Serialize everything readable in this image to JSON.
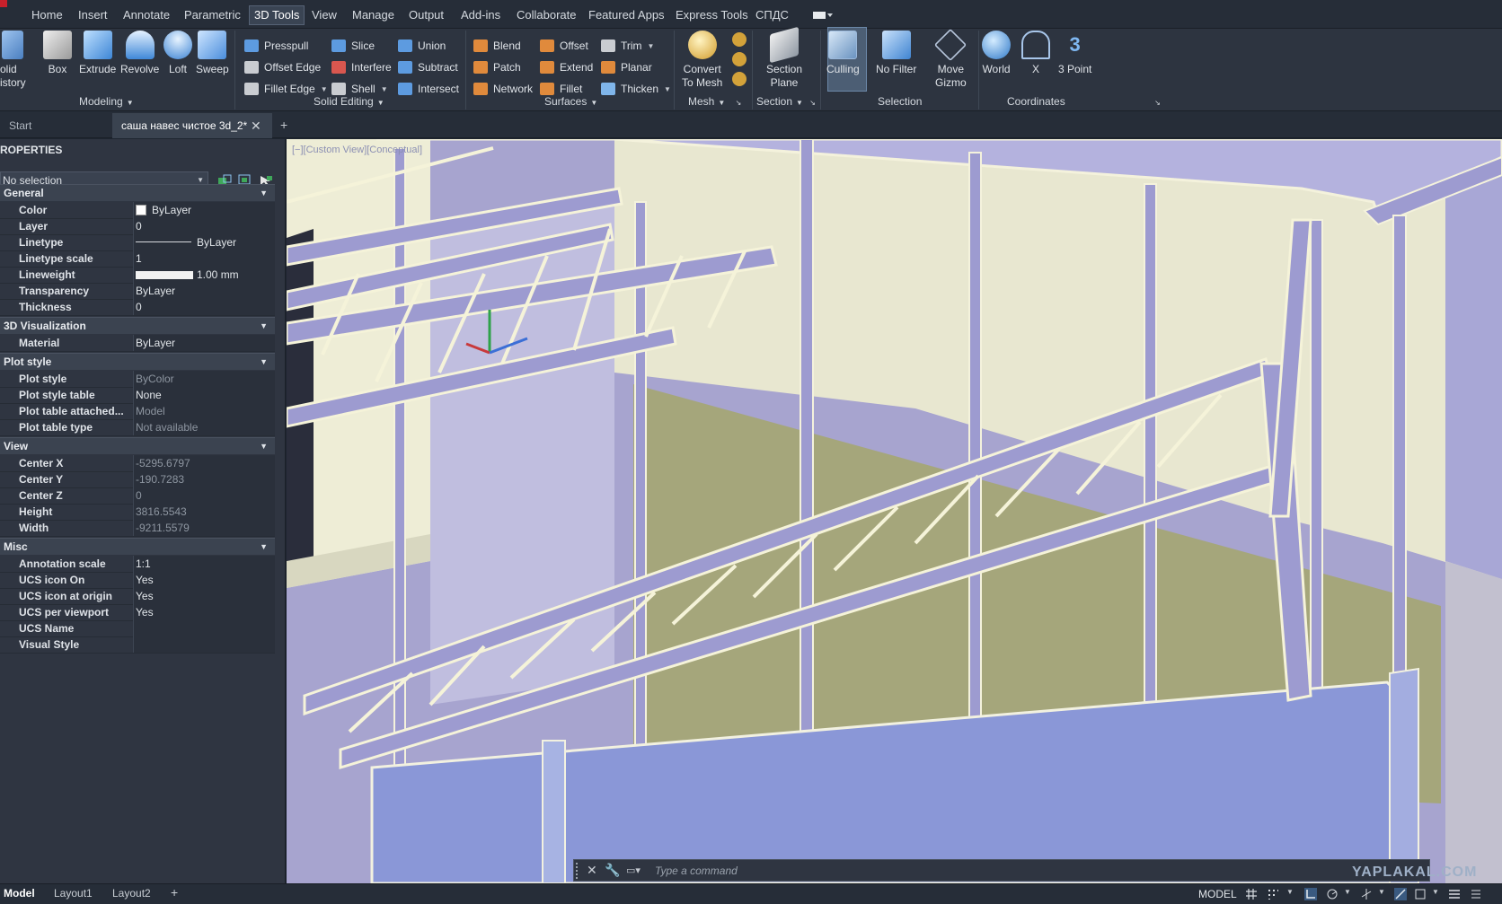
{
  "menubar": {
    "tabs": [
      "Home",
      "Insert",
      "Annotate",
      "Parametric",
      "3D Tools",
      "View",
      "Manage",
      "Output",
      "Add-ins",
      "Collaborate",
      "Featured Apps",
      "Express Tools",
      "СПДС"
    ],
    "active_tab": "3D Tools"
  },
  "ribbon": {
    "modeling": {
      "title": "Modeling",
      "solid_history": "olid\nistory",
      "box": "Box",
      "extrude": "Extrude",
      "revolve": "Revolve",
      "loft": "Loft",
      "sweep": "Sweep"
    },
    "solid_editing": {
      "title": "Solid Editing",
      "presspull": "Presspull",
      "offset_edge": "Offset Edge",
      "fillet_edge": "Fillet Edge",
      "slice": "Slice",
      "interfere": "Interfere",
      "shell": "Shell",
      "union": "Union",
      "subtract": "Subtract",
      "intersect": "Intersect"
    },
    "surfaces": {
      "title": "Surfaces",
      "blend": "Blend",
      "patch": "Patch",
      "network": "Network",
      "offset": "Offset",
      "extend": "Extend",
      "fillet": "Fillet",
      "trim": "Trim",
      "planar": "Planar",
      "thicken": "Thicken"
    },
    "mesh": {
      "title": "Mesh",
      "convert_to_mesh": "Convert\nTo Mesh"
    },
    "section": {
      "title": "Section",
      "section_plane": "Section\nPlane"
    },
    "selection": {
      "title": "Selection",
      "culling": "Culling",
      "no_filter": "No Filter",
      "move_gizmo": "Move\nGizmo"
    },
    "coordinates": {
      "title": "Coordinates",
      "world": "World",
      "x": "X",
      "three_point": "3 Point"
    }
  },
  "doc_tabs": {
    "start": "Start",
    "drawing": "саша навес чистое 3d_2*"
  },
  "properties": {
    "title": "ROPERTIES",
    "selection": "No selection",
    "sections": {
      "general": "General",
      "visualization": "3D Visualization",
      "plot_style": "Plot style",
      "view": "View",
      "misc": "Misc"
    },
    "general": [
      {
        "name": "Color",
        "value": "ByLayer"
      },
      {
        "name": "Layer",
        "value": "0"
      },
      {
        "name": "Linetype",
        "value": "ByLayer"
      },
      {
        "name": "Linetype scale",
        "value": "1"
      },
      {
        "name": "Lineweight",
        "value": "1.00 mm"
      },
      {
        "name": "Transparency",
        "value": "ByLayer"
      },
      {
        "name": "Thickness",
        "value": "0"
      }
    ],
    "visualization": [
      {
        "name": "Material",
        "value": "ByLayer"
      }
    ],
    "plot_style": [
      {
        "name": "Plot style",
        "value": "ByColor"
      },
      {
        "name": "Plot style table",
        "value": "None"
      },
      {
        "name": "Plot table attached...",
        "value": "Model"
      },
      {
        "name": "Plot table type",
        "value": "Not available"
      }
    ],
    "view": [
      {
        "name": "Center X",
        "value": "-5295.6797"
      },
      {
        "name": "Center Y",
        "value": "-190.7283"
      },
      {
        "name": "Center Z",
        "value": "0"
      },
      {
        "name": "Height",
        "value": "3816.5543"
      },
      {
        "name": "Width",
        "value": "-9211.5579"
      }
    ],
    "misc": [
      {
        "name": "Annotation scale",
        "value": "1:1"
      },
      {
        "name": "UCS icon On",
        "value": "Yes"
      },
      {
        "name": "UCS icon at origin",
        "value": "Yes"
      },
      {
        "name": "UCS per viewport",
        "value": "Yes"
      },
      {
        "name": "UCS Name",
        "value": ""
      },
      {
        "name": "Visual Style",
        "value": ""
      }
    ]
  },
  "viewport": {
    "label": "[−][Custom View][Conceptual]"
  },
  "command": {
    "placeholder": "Type a command"
  },
  "statusbar": {
    "layouts": [
      "Model",
      "Layout1",
      "Layout2"
    ],
    "mode": "MODEL",
    "watermark": "YAPLAKAL.COM"
  },
  "colors": {
    "accent": "#4c5e74",
    "truss": "#9d9bd0",
    "truss_highlight": "#f5f3d9",
    "wall": "#e9e8d2",
    "olive": "#a6a67a",
    "panel_blue": "#8694d6"
  }
}
